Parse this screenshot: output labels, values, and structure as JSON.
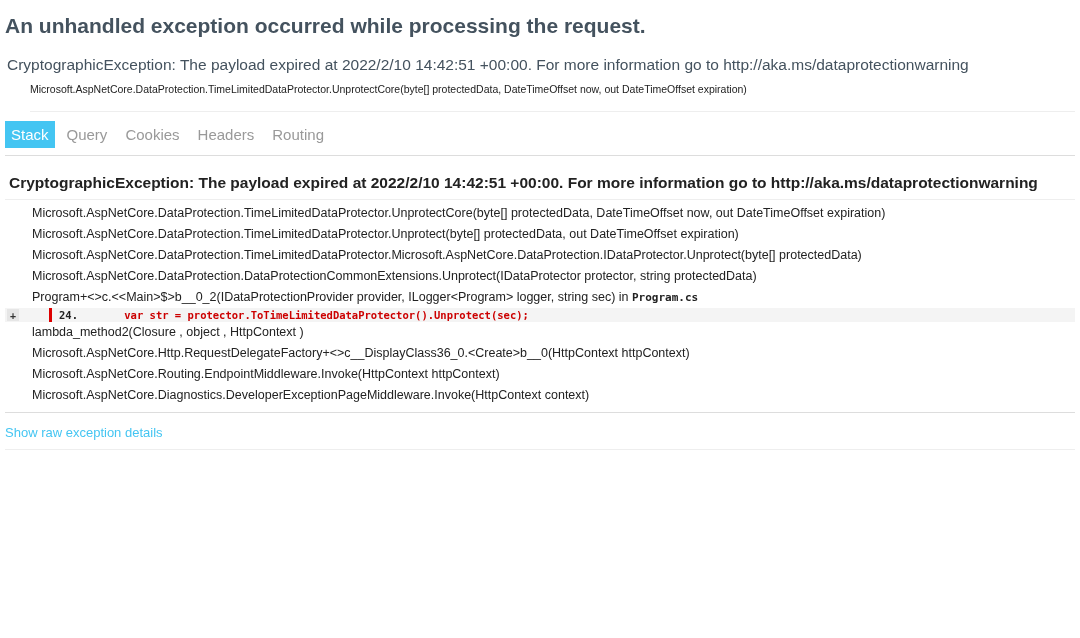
{
  "title": "An unhandled exception occurred while processing the request.",
  "error": {
    "message": "CryptographicException: The payload expired at 2022/2/10 14:42:51 +00:00. For more information go to http://aka.ms/dataprotectionwarning",
    "location": "Microsoft.AspNetCore.DataProtection.TimeLimitedDataProtector.UnprotectCore(byte[] protectedData, DateTimeOffset now, out DateTimeOffset expiration)"
  },
  "tabs": [
    {
      "label": "Stack",
      "selected": true
    },
    {
      "label": "Query",
      "selected": false
    },
    {
      "label": "Cookies",
      "selected": false
    },
    {
      "label": "Headers",
      "selected": false
    },
    {
      "label": "Routing",
      "selected": false
    }
  ],
  "stack": {
    "heading": "CryptographicException: The payload expired at 2022/2/10 14:42:51 +00:00. For more information go to http://aka.ms/dataprotectionwarning",
    "frames": [
      {
        "kind": "method",
        "method": "Microsoft.AspNetCore.DataProtection.TimeLimitedDataProtector.UnprotectCore(byte[] protectedData, DateTimeOffset now, out DateTimeOffset expiration)"
      },
      {
        "kind": "method",
        "method": "Microsoft.AspNetCore.DataProtection.TimeLimitedDataProtector.Unprotect(byte[] protectedData, out DateTimeOffset expiration)"
      },
      {
        "kind": "method",
        "method": "Microsoft.AspNetCore.DataProtection.TimeLimitedDataProtector.Microsoft.AspNetCore.DataProtection.IDataProtector.Unprotect(byte[] protectedData)"
      },
      {
        "kind": "method",
        "method": "Microsoft.AspNetCore.DataProtection.DataProtectionCommonExtensions.Unprotect(IDataProtector protector, string protectedData)"
      },
      {
        "kind": "source",
        "method": "Program+<>c.<<Main>$>b__0_2(IDataProtectionProvider provider, ILogger<Program> logger, string sec) in",
        "file": "Program.cs",
        "toggle": "+",
        "line_number": "24.",
        "code": "    var str = protector.ToTimeLimitedDataProtector().Unprotect(sec);"
      },
      {
        "kind": "method",
        "method": "lambda_method2(Closure , object , HttpContext )"
      },
      {
        "kind": "method",
        "method": "Microsoft.AspNetCore.Http.RequestDelegateFactory+<>c__DisplayClass36_0.<Create>b__0(HttpContext httpContext)"
      },
      {
        "kind": "method",
        "method": "Microsoft.AspNetCore.Routing.EndpointMiddleware.Invoke(HttpContext httpContext)"
      },
      {
        "kind": "method",
        "method": "Microsoft.AspNetCore.Diagnostics.DeveloperExceptionPageMiddleware.Invoke(HttpContext context)"
      }
    ]
  },
  "raw_link": "Show raw exception details"
}
